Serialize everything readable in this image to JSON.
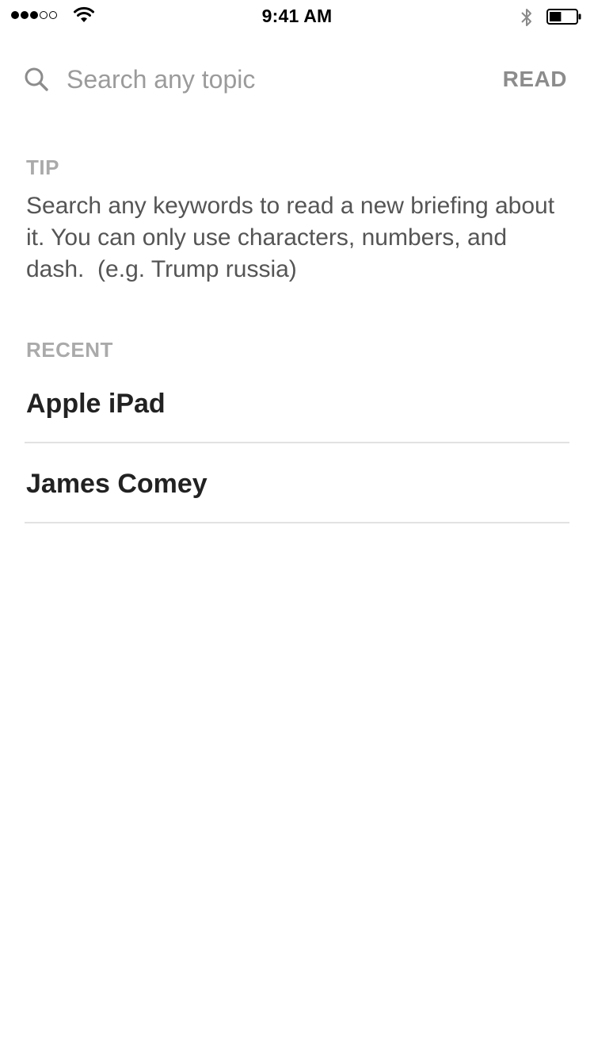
{
  "status_bar": {
    "time": "9:41 AM",
    "signal_icon": "signal-dots-icon",
    "wifi_icon": "wifi-icon",
    "bluetooth_icon": "bluetooth-icon",
    "battery_icon": "battery-icon",
    "battery_level": 0.45
  },
  "search": {
    "icon": "search-icon",
    "placeholder": "Search any topic",
    "value": "",
    "read_label": "READ"
  },
  "tip": {
    "label": "TIP",
    "text": "Search any keywords to read a new briefing about it. You can only use characters, numbers, and dash.  (e.g. Trump russia)"
  },
  "recent": {
    "label": "RECENT",
    "items": [
      {
        "label": "Apple iPad"
      },
      {
        "label": "James Comey"
      }
    ]
  },
  "colors": {
    "placeholder": "#9b9b9b",
    "section_label": "#aaaaaa",
    "body_text": "#555555",
    "item_text": "#222222",
    "divider": "#e2e2e2",
    "read_button": "#8c8c8c"
  }
}
